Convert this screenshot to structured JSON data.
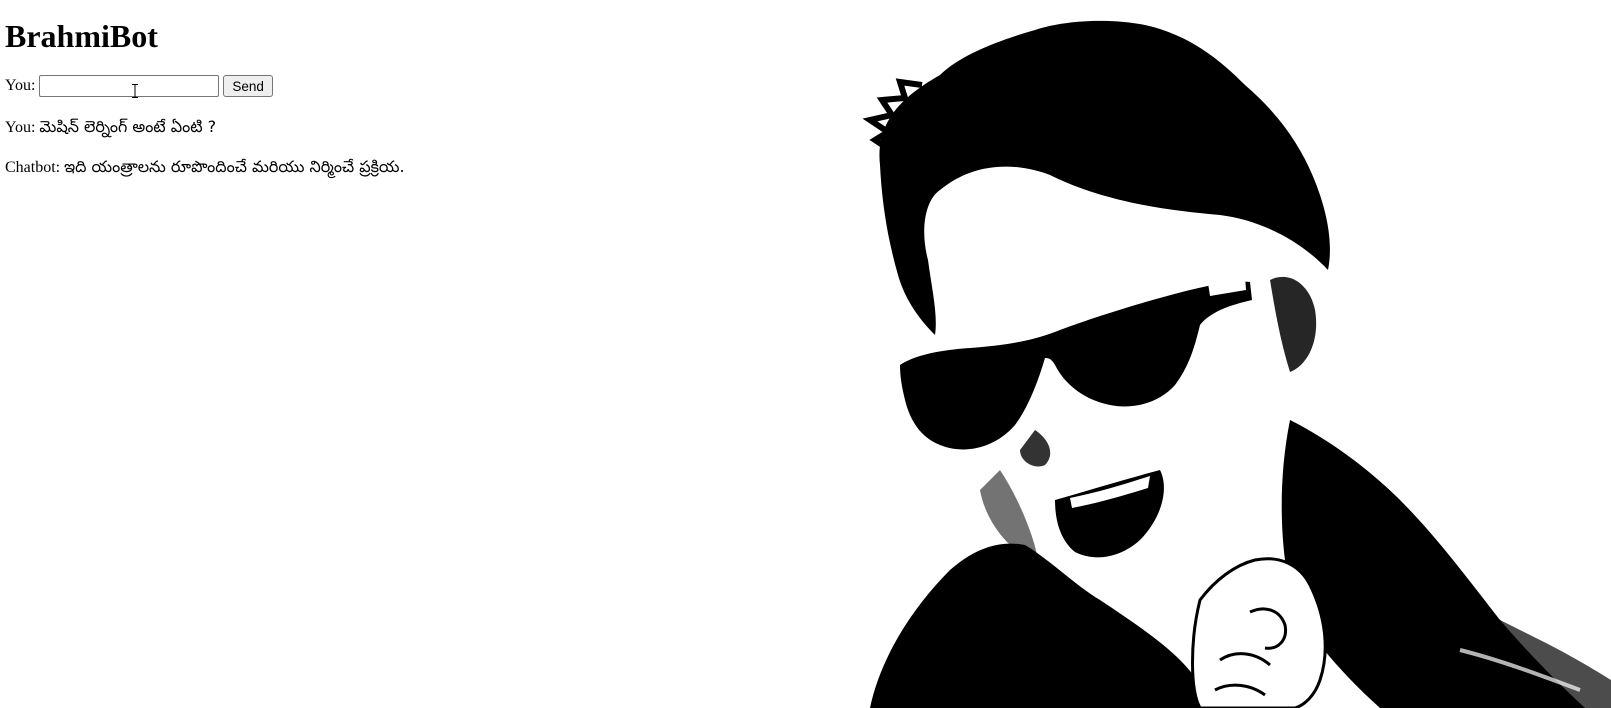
{
  "app": {
    "title": "BrahmiBot"
  },
  "input": {
    "label": "You:",
    "value": "",
    "placeholder": ""
  },
  "send_button": {
    "label": "Send"
  },
  "conversation": [
    {
      "speaker": "You:",
      "text": "మెషిన్ లెర్నింగ్ అంటే ఏంటి ?"
    },
    {
      "speaker": "Chatbot:",
      "text": "ఇది యంత్రాలను రూపొందించే మరియు నిర్మించే ప్రక్రియ."
    }
  ],
  "colors": {
    "background": "#ffffff",
    "text": "#000000",
    "button_bg": "#efefef",
    "border": "#767676"
  },
  "icons": {
    "cursor": "text-cursor-icon"
  }
}
